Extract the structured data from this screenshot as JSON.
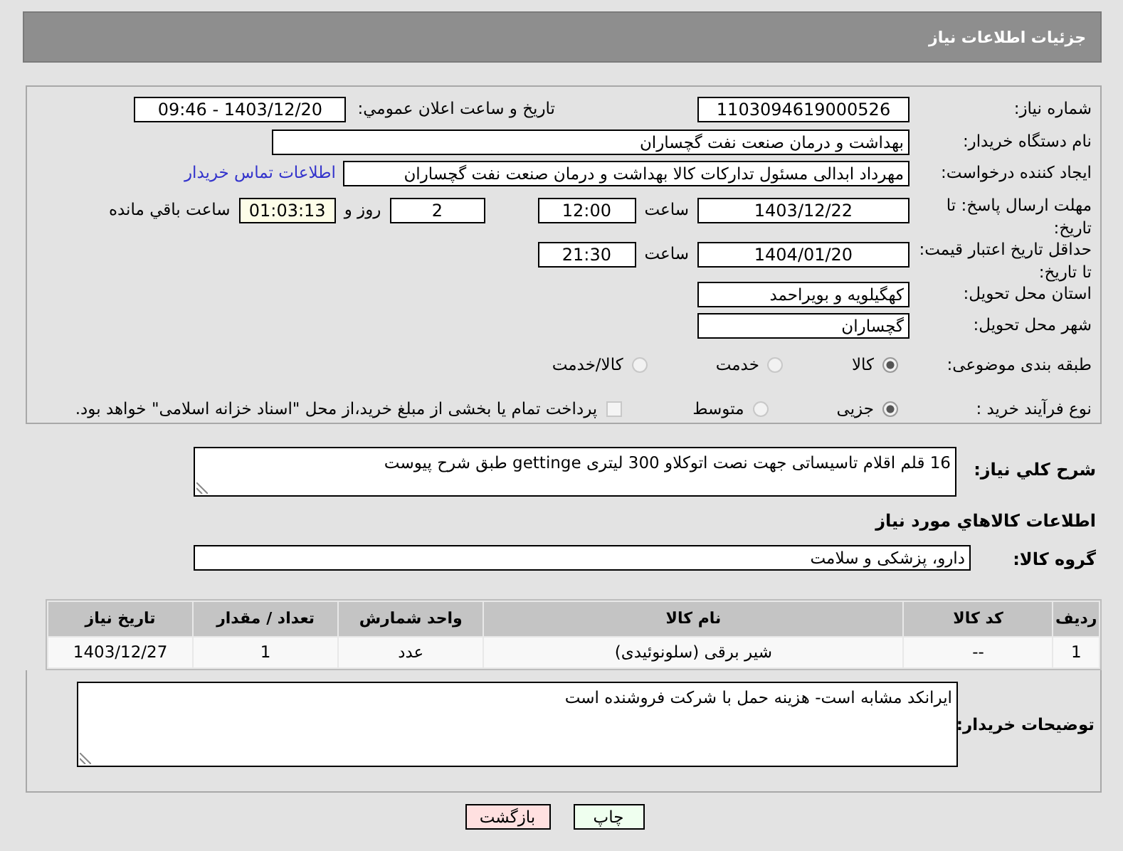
{
  "header": {
    "title": "جزئیات اطلاعات نیاز"
  },
  "need_number": {
    "label": "شماره نیاز:",
    "value": "1103094619000526"
  },
  "announce": {
    "label": "تاریخ و ساعت اعلان عمومي:",
    "value": "1403/12/20 - 09:46"
  },
  "buyer_org": {
    "label": "نام دستگاه خریدار:",
    "value": "بهداشت و درمان صنعت نفت گچساران"
  },
  "requester": {
    "label": "ایجاد کننده درخواست:",
    "value": "مهرداد ابدالی مسئول تدارکات کالا  بهداشت و درمان صنعت نفت گچساران",
    "link": "اطلاعات تماس خریدار"
  },
  "reply_deadline": {
    "label": "مهلت ارسال پاسخ: تا تاریخ:",
    "date": "1403/12/22",
    "time_label": "ساعت",
    "time": "12:00",
    "days": "2",
    "days_label": "روز و",
    "remaining": "01:03:13",
    "remaining_label": "ساعت باقي مانده"
  },
  "price_validity": {
    "label": "حداقل تاریخ اعتبار قیمت: تا تاریخ:",
    "date": "1404/01/20",
    "time_label": "ساعت",
    "time": "21:30"
  },
  "province": {
    "label": "استان محل تحویل:",
    "value": "کهگیلویه و بویراحمد"
  },
  "city": {
    "label": "شهر محل تحویل:",
    "value": "گچساران"
  },
  "category": {
    "label": "طبقه بندی موضوعی:",
    "options": [
      {
        "label": "کالا",
        "selected": true
      },
      {
        "label": "خدمت",
        "selected": false
      },
      {
        "label": "کالا/خدمت",
        "selected": false
      }
    ]
  },
  "purchase_type": {
    "label": "نوع فرآیند خرید :",
    "options": [
      {
        "label": "جزیی",
        "selected": true
      },
      {
        "label": "متوسط",
        "selected": false
      }
    ],
    "treasury": {
      "checked": false,
      "label": "پرداخت تمام یا بخشی از مبلغ خرید،از محل \"اسناد خزانه اسلامی\" خواهد بود."
    }
  },
  "description": {
    "label": "شرح کلي نياز:",
    "value": "16 قلم اقلام تاسیساتی جهت نصت اتوکلاو 300 لیتری gettinge طبق شرح پیوست"
  },
  "goods_title": "اطلاعات کالاهاي مورد نياز",
  "goods_group": {
    "label": "گروه کالا:",
    "value": "دارو، پزشکی و سلامت"
  },
  "table": {
    "columns": [
      "ردیف",
      "کد کالا",
      "نام کالا",
      "واحد شمارش",
      "تعداد / مقدار",
      "تاریخ نیاز"
    ],
    "rows": [
      [
        "1",
        "--",
        "شیر برقی (سلونوئیدی)",
        "عدد",
        "1",
        "1403/12/27"
      ]
    ]
  },
  "buyer_notes": {
    "label": "توضیحات خریدار:",
    "value": "ایرانکد مشابه است- هزینه حمل با شرکت فروشنده است"
  },
  "buttons": [
    {
      "label": "چاپ",
      "kind": "print"
    },
    {
      "label": "بازگشت",
      "kind": "back"
    }
  ]
}
